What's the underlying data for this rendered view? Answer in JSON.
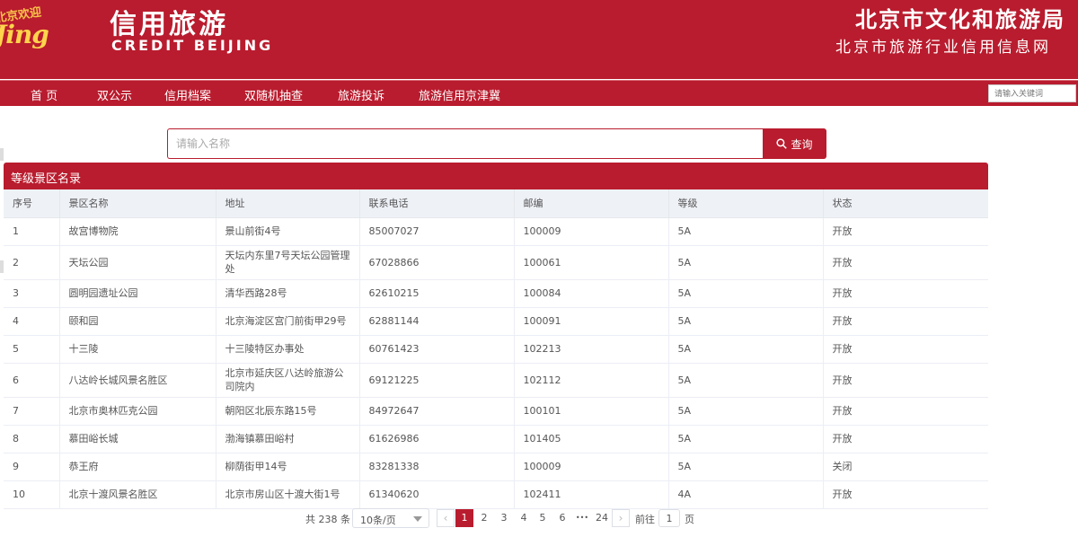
{
  "header": {
    "logo_line1": "北京欢迎",
    "logo_line2": "Jing",
    "brand_cn": "信用旅游",
    "brand_en": "CREDIT BEIJING",
    "org_cn": "北京市文化和旅游局",
    "org_sub": "北京市旅游行业信用信息网"
  },
  "nav": {
    "items": [
      "首 页",
      "双公示",
      "信用档案",
      "双随机抽查",
      "旅游投诉",
      "旅游信用京津冀"
    ],
    "search_placeholder": "请输入关键词"
  },
  "search": {
    "placeholder": "请输入名称",
    "button_label": "查询"
  },
  "panel": {
    "title": "等级景区名录"
  },
  "table": {
    "columns": [
      "序号",
      "景区名称",
      "地址",
      "联系电话",
      "邮编",
      "等级",
      "状态"
    ],
    "rows": [
      [
        "1",
        "故宫博物院",
        "景山前街4号",
        "85007027",
        "100009",
        "5A",
        "开放"
      ],
      [
        "2",
        "天坛公园",
        "天坛内东里7号天坛公园管理处",
        "67028866",
        "100061",
        "5A",
        "开放"
      ],
      [
        "3",
        "圆明园遗址公园",
        "清华西路28号",
        "62610215",
        "100084",
        "5A",
        "开放"
      ],
      [
        "4",
        "颐和园",
        "北京海淀区宫门前街甲29号",
        "62881144",
        "100091",
        "5A",
        "开放"
      ],
      [
        "5",
        "十三陵",
        "十三陵特区办事处",
        "60761423",
        "102213",
        "5A",
        "开放"
      ],
      [
        "6",
        "八达岭长城风景名胜区",
        "北京市延庆区八达岭旅游公司院内",
        "69121225",
        "102112",
        "5A",
        "开放"
      ],
      [
        "7",
        "北京市奥林匹克公园",
        "朝阳区北辰东路15号",
        "84972647",
        "100101",
        "5A",
        "开放"
      ],
      [
        "8",
        "慕田峪长城",
        "渤海镇慕田峪村",
        "61626986",
        "101405",
        "5A",
        "开放"
      ],
      [
        "9",
        "恭王府",
        "柳荫街甲14号",
        "83281338",
        "100009",
        "5A",
        "关闭"
      ],
      [
        "10",
        "北京十渡风景名胜区",
        "北京市房山区十渡大街1号",
        "61340620",
        "102411",
        "4A",
        "开放"
      ]
    ]
  },
  "pager": {
    "total_text": "共 238 条",
    "page_size": "10条/页",
    "pages": [
      "1",
      "2",
      "3",
      "4",
      "5",
      "6",
      "•••",
      "24"
    ],
    "current_page": "1",
    "goto_label": "前往",
    "goto_value": "1",
    "goto_suffix": "页"
  },
  "colors": {
    "brand_red": "#b91c2e",
    "header_bg": "#eef1f6"
  }
}
